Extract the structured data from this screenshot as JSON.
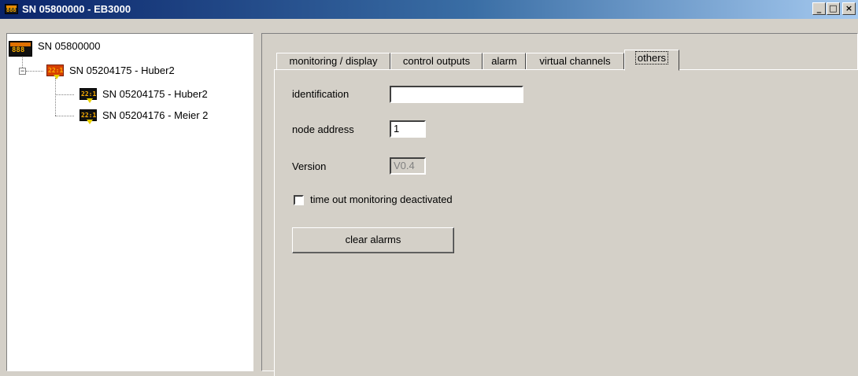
{
  "window": {
    "title": "SN 05800000 - EB3000",
    "minimize": "_",
    "maximize": "□",
    "close": "×"
  },
  "tree": {
    "root": {
      "label": "SN 05800000",
      "icon": "device-display-icon"
    },
    "expander": "−",
    "group": {
      "label": "SN 05204175 - Huber2",
      "icon": "device-red-icon"
    },
    "children": [
      {
        "label": "SN 05204175 - Huber2",
        "icon": "device-icon"
      },
      {
        "label": "SN 05204176 - Meier 2",
        "icon": "device-icon"
      }
    ]
  },
  "tabs": [
    {
      "label": "monitoring / display",
      "active": false
    },
    {
      "label": "control outputs",
      "active": false
    },
    {
      "label": "alarm",
      "active": false
    },
    {
      "label": "virtual channels",
      "active": false
    },
    {
      "label": "others",
      "active": true
    }
  ],
  "others": {
    "identification_label": "identification",
    "identification_value": "",
    "node_address_label": "node address",
    "node_address_value": "1",
    "version_label": "Version",
    "version_value": "V0.4",
    "timeout_label": "time out monitoring deactivated",
    "timeout_checked": false,
    "clear_alarms_label": "clear alarms"
  },
  "colors": {
    "title_bar_start": "#0a246a",
    "title_bar_end": "#a6caf0",
    "face": "#d4d0c8",
    "device_accent": "#e07000"
  }
}
